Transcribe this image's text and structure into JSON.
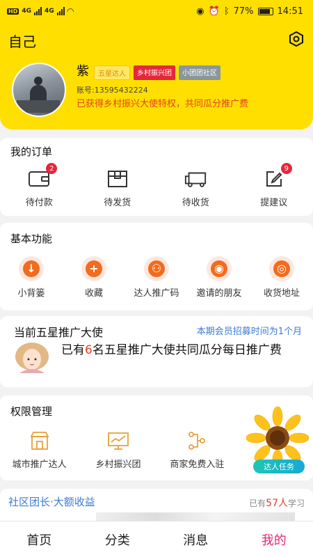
{
  "status_bar": {
    "left_text": "HD",
    "network_4g_1": "4G",
    "network_4g_2": "4G",
    "battery_pct": "77%",
    "time": "14:51"
  },
  "header": {
    "title": "自己",
    "username": "紫",
    "badges": [
      "五星达人",
      "乡村振兴团",
      "小团团社区"
    ],
    "account": "账号:13595432224",
    "privilege": "已获得乡村振兴大使特权，共同瓜分推广费"
  },
  "orders": {
    "title": "我的订单",
    "items": [
      {
        "label": "待付款",
        "icon": "wallet-icon",
        "badge": "2"
      },
      {
        "label": "待发货",
        "icon": "package-icon",
        "badge": ""
      },
      {
        "label": "待收货",
        "icon": "truck-icon",
        "badge": ""
      },
      {
        "label": "提建议",
        "icon": "edit-icon",
        "badge": "9"
      }
    ]
  },
  "functions": {
    "title": "基本功能",
    "items": [
      {
        "label": "小背篓",
        "glyph": "↓"
      },
      {
        "label": "收藏",
        "glyph": "+"
      },
      {
        "label": "达人推广码",
        "glyph": "⚇"
      },
      {
        "label": "邀请的朋友",
        "glyph": "◉"
      },
      {
        "label": "收货地址",
        "glyph": "◎"
      }
    ]
  },
  "ambassador": {
    "title": "当前五星推广大使",
    "link": "本期会员招募时间为1个月",
    "text_before": "已有",
    "count": "6",
    "text_after": "名五星推广大使共同瓜分每日推广费"
  },
  "permissions": {
    "title": "权限管理",
    "items": [
      {
        "label": "城市推广达人",
        "icon": "shop-icon"
      },
      {
        "label": "乡村振兴团",
        "icon": "chart-board-icon"
      },
      {
        "label": "商家免费入驻",
        "icon": "flow-icon"
      }
    ],
    "task_button": "达人任务"
  },
  "community": {
    "title": "社区团长·大额收益",
    "learn_before": "已有",
    "learn_count": "57人",
    "learn_after": "学习"
  },
  "tabs": [
    "首页",
    "分类",
    "消息",
    "我的"
  ],
  "colors": {
    "brand_yellow": "#ffdf00",
    "accent_red": "#e6273a",
    "orange": "#f36b1d",
    "link_blue": "#3a7bd5",
    "active_tab": "#e6277a"
  }
}
